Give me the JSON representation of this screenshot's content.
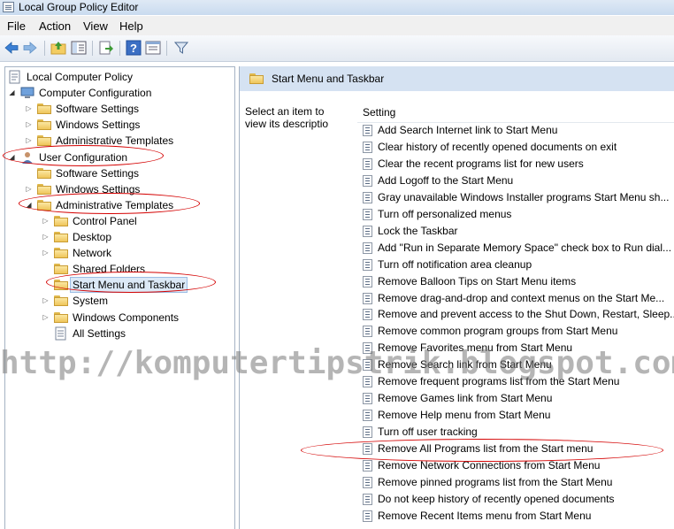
{
  "window": {
    "title": "Local Group Policy Editor"
  },
  "menu": [
    "File",
    "Action",
    "View",
    "Help"
  ],
  "toolbar": [
    {
      "icon": "back-arrow-icon"
    },
    {
      "icon": "forward-arrow-icon"
    },
    {
      "icon": "up-folder-icon"
    },
    {
      "icon": "show-hide-tree-icon"
    },
    {
      "icon": "export-list-icon"
    },
    {
      "icon": "help-icon"
    },
    {
      "icon": "properties-icon"
    },
    {
      "icon": "filter-icon"
    }
  ],
  "tree": [
    {
      "label": "Local Computer Policy",
      "level": 0,
      "expander": "",
      "icon": "policy"
    },
    {
      "label": "Computer Configuration",
      "level": 1,
      "expander": "open",
      "icon": "computer"
    },
    {
      "label": "Software Settings",
      "level": 2,
      "expander": "closed",
      "icon": "folder"
    },
    {
      "label": "Windows Settings",
      "level": 2,
      "expander": "closed",
      "icon": "folder"
    },
    {
      "label": "Administrative Templates",
      "level": 2,
      "expander": "closed",
      "icon": "folder"
    },
    {
      "label": "User Configuration",
      "level": 1,
      "expander": "open",
      "icon": "user"
    },
    {
      "label": "Software Settings",
      "level": 2,
      "expander": "",
      "icon": "folder"
    },
    {
      "label": "Windows Settings",
      "level": 2,
      "expander": "closed",
      "icon": "folder"
    },
    {
      "label": "Administrative Templates",
      "level": 2,
      "expander": "open",
      "icon": "folder"
    },
    {
      "label": "Control Panel",
      "level": 3,
      "expander": "closed",
      "icon": "folder"
    },
    {
      "label": "Desktop",
      "level": 3,
      "expander": "closed",
      "icon": "folder"
    },
    {
      "label": "Network",
      "level": 3,
      "expander": "closed",
      "icon": "folder"
    },
    {
      "label": "Shared Folders",
      "level": 3,
      "expander": "",
      "icon": "folder"
    },
    {
      "label": "Start Menu and Taskbar",
      "level": 3,
      "expander": "",
      "icon": "folder",
      "selected": true
    },
    {
      "label": "System",
      "level": 3,
      "expander": "closed",
      "icon": "folder"
    },
    {
      "label": "Windows Components",
      "level": 3,
      "expander": "closed",
      "icon": "folder"
    },
    {
      "label": "All Settings",
      "level": 3,
      "expander": "",
      "icon": "all-settings"
    }
  ],
  "right": {
    "title": "Start Menu and Taskbar",
    "description": "Select an item to view its descriptio",
    "column_header": "Setting",
    "settings": [
      "Add Search Internet link to Start Menu",
      "Clear history of recently opened documents on exit",
      "Clear the recent programs list for new users",
      "Add Logoff to the Start Menu",
      "Gray unavailable Windows Installer programs Start Menu sh...",
      "Turn off personalized menus",
      "Lock the Taskbar",
      "Add \"Run in Separate Memory Space\" check box to Run dial...",
      "Turn off notification area cleanup",
      "Remove Balloon Tips on Start Menu items",
      "Remove drag-and-drop and context menus on the Start Me...",
      "Remove and prevent access to the Shut Down, Restart, Sleep...",
      "Remove common program groups from Start Menu",
      "Remove Favorites menu from Start Menu",
      "Remove Search link from Start Menu",
      "Remove frequent programs list from the Start Menu",
      "Remove Games link from Start Menu",
      "Remove Help menu from Start Menu",
      "Turn off user tracking",
      "Remove All Programs list from the Start menu",
      "Remove Network Connections from Start Menu",
      "Remove pinned programs list from the Start Menu",
      "Do not keep history of recently opened documents",
      "Remove Recent Items menu from Start Menu"
    ]
  },
  "watermark": "http://komputertipstrik.blogspot.com",
  "colors": {
    "annotation": "#d40000",
    "header_bg": "#d5e2f2",
    "selection": "#dce9f7"
  }
}
